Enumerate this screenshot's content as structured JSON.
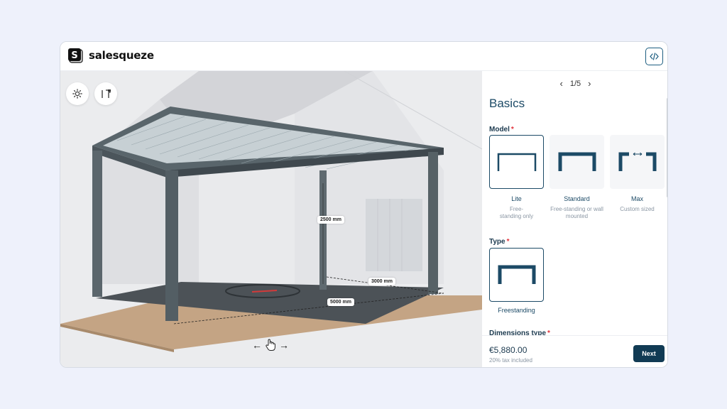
{
  "app": {
    "brand": "salesqueze"
  },
  "viewer": {
    "dimensions": {
      "height": "2500 mm",
      "depth": "3000 mm",
      "width": "5000 mm"
    }
  },
  "panel": {
    "pager": {
      "current": "1/5"
    },
    "section_title": "Basics",
    "model": {
      "label": "Model",
      "required_mark": "*",
      "options": [
        {
          "name": "Lite",
          "desc": "Free-standing only",
          "selected": true
        },
        {
          "name": "Standard",
          "desc": "Free-standing or wall mounted",
          "selected": false
        },
        {
          "name": "Max",
          "desc": "Custom sized",
          "selected": false
        }
      ]
    },
    "type": {
      "label": "Type",
      "required_mark": "*",
      "options": [
        {
          "name": "Freestanding",
          "selected": true
        }
      ]
    },
    "dimensions_type": {
      "label": "Dimensions type",
      "required_mark": "*"
    },
    "footer": {
      "price": "€5,880.00",
      "tax_note": "20% tax included",
      "next_label": "Next"
    }
  },
  "colors": {
    "accent": "#113b54",
    "required": "#e0323a"
  }
}
